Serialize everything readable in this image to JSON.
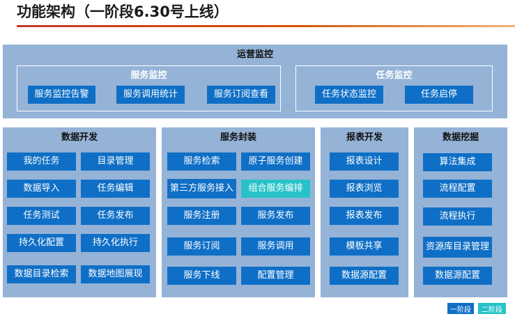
{
  "title": "功能架构（一阶段6.30号上线）",
  "ops": {
    "title": "运营监控",
    "service_monitor": {
      "title": "服务监控",
      "items": [
        "服务监控告警",
        "服务调用统计",
        "服务订阅查看"
      ]
    },
    "task_monitor": {
      "title": "任务监控",
      "items": [
        "任务状态监控",
        "任务启停"
      ]
    }
  },
  "data_dev": {
    "title": "数据开发",
    "items": [
      "我的任务",
      "目录管理",
      "数据导入",
      "任务编辑",
      "任务测试",
      "任务发布",
      "持久化配置",
      "持久化执行",
      "数据目录检索",
      "数据地图展现"
    ]
  },
  "service_pkg": {
    "title": "服务封装",
    "items": [
      "服务检索",
      "原子服务创建",
      "第三方服务接入",
      "组合服务编排",
      "服务注册",
      "服务发布",
      "服务订阅",
      "服务调用",
      "服务下线",
      "配置管理"
    ]
  },
  "report_dev": {
    "title": "报表开发",
    "items": [
      "报表设计",
      "报表浏览",
      "报表发布",
      "模板共享",
      "数据源配置"
    ]
  },
  "data_mining": {
    "title": "数据挖掘",
    "items": [
      "算法集成",
      "流程配置",
      "流程执行",
      "资源库目录管理",
      "数据源配置"
    ]
  },
  "legend": {
    "phase1": "一阶段",
    "phase2": "二阶段"
  },
  "colors": {
    "panel": "#95b3d7",
    "phase1": "#0f6fc6",
    "phase2": "#27c2c9"
  }
}
